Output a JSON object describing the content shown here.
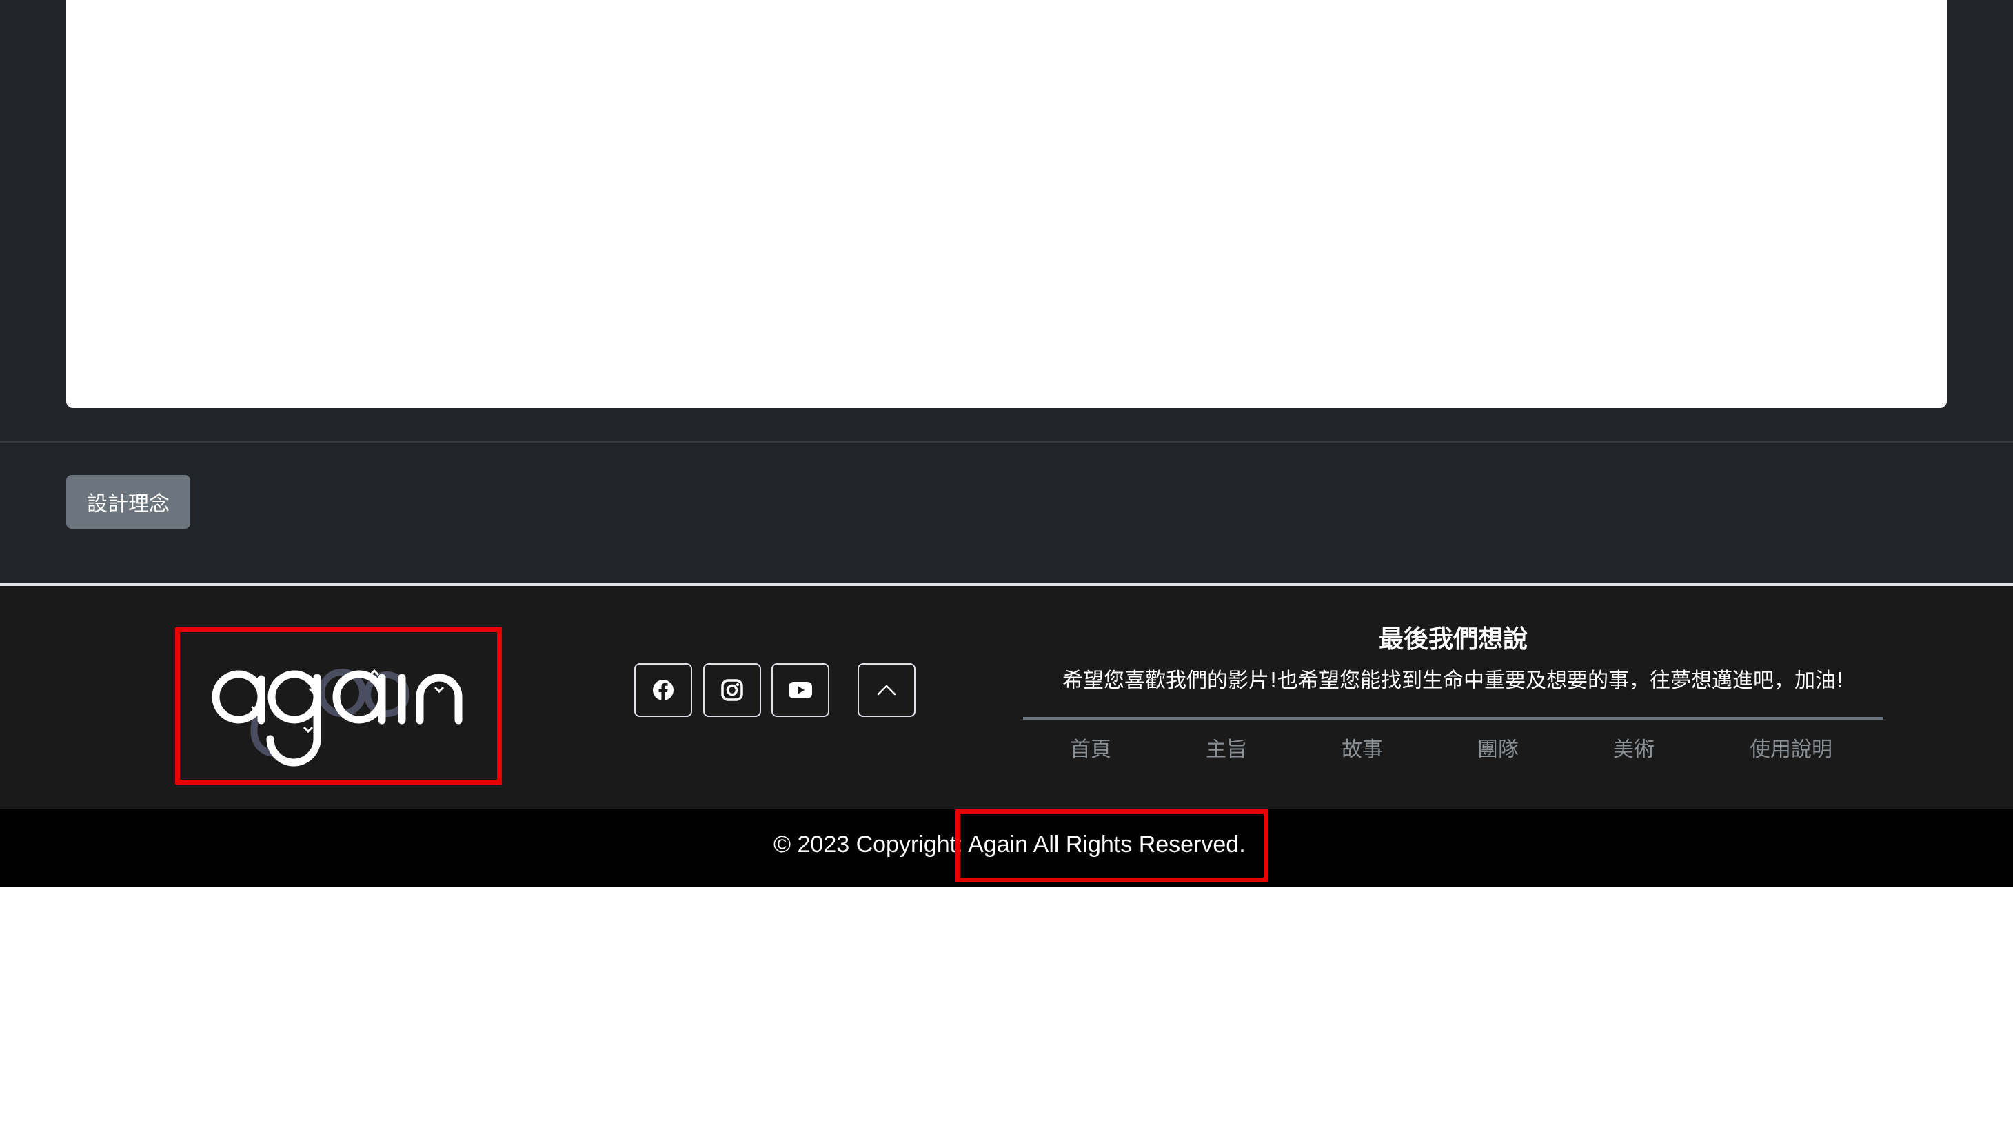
{
  "content": {
    "design_button_label": "設計理念"
  },
  "footer": {
    "logo_text": "again",
    "social": {
      "facebook": "facebook-icon",
      "instagram": "instagram-icon",
      "youtube": "youtube-icon",
      "back_to_top": "chevron-up-icon"
    },
    "title": "最後我們想說",
    "message": "希望您喜歡我們的影片!也希望您能找到生命中重要及想要的事，往夢想邁進吧，加油!",
    "nav": [
      {
        "label": "首頁"
      },
      {
        "label": "主旨"
      },
      {
        "label": "故事"
      },
      {
        "label": "團隊"
      },
      {
        "label": "美術"
      },
      {
        "label": "使用說明"
      }
    ]
  },
  "copyright": {
    "text": "© 2023 Copyright: Again All Rights Reserved."
  },
  "colors": {
    "dark_bg": "#212529",
    "footer_bg": "#1a1a1b",
    "copyright_bg": "#000000",
    "button_gray": "#6c757d",
    "highlight_red": "#e60000",
    "nav_gray": "#8a8f94"
  }
}
